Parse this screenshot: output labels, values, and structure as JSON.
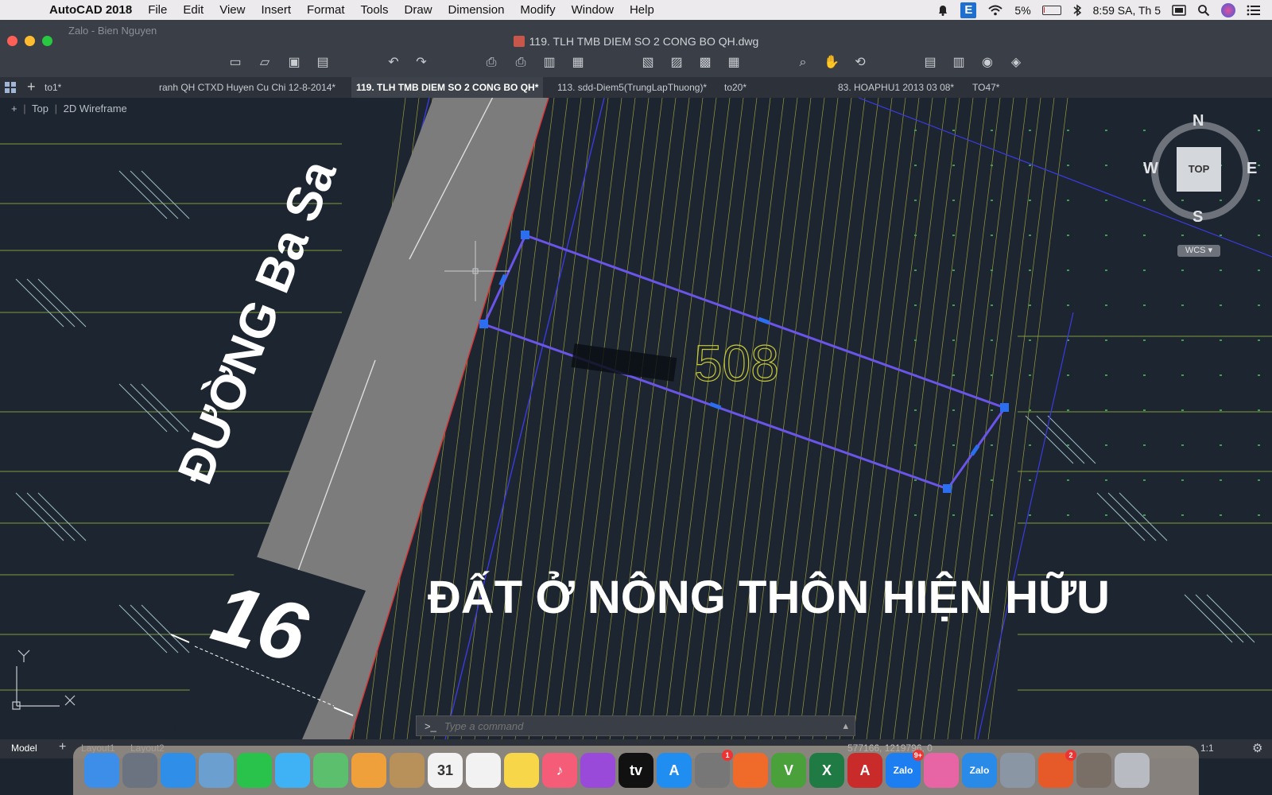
{
  "menubar": {
    "app_name": "AutoCAD 2018",
    "items": [
      "File",
      "Edit",
      "View",
      "Insert",
      "Format",
      "Tools",
      "Draw",
      "Dimension",
      "Modify",
      "Window",
      "Help"
    ],
    "battery": "5%",
    "clock": "8:59 SA, Th 5",
    "input_source": "E"
  },
  "window": {
    "title": "119. TLH TMB DIEM SO 2 CONG BO QH.dwg",
    "behind_window": "Zalo - Bien Nguyen"
  },
  "tabs": [
    {
      "label": "to1*"
    },
    {
      "label": "ranh QH CTXD Huyen Cu Chi 12-8-2014*"
    },
    {
      "label": "119. TLH TMB DIEM SO 2 CONG BO QH*",
      "active": true
    },
    {
      "label": "113. sdd-Diem5(TrungLapThuong)*"
    },
    {
      "label": "to20*"
    },
    {
      "label": "83. HOAPHU1 2013 03 08*"
    },
    {
      "label": "TO47*"
    }
  ],
  "viewport": {
    "view_label": "Top",
    "style_label": "2D Wireframe",
    "parcel_number": "508",
    "road_name": "ĐƯỜNG Ba Sa",
    "road_width": "16",
    "overlay_caption": "ĐẤT Ở NÔNG THÔN HIỆN HỮU",
    "viewcube": {
      "n": "N",
      "s": "S",
      "e": "E",
      "w": "W",
      "face": "TOP",
      "ucs": "WCS"
    },
    "ucs_axes": {
      "y": "Y",
      "x": "X"
    }
  },
  "command": {
    "prompt": ">_",
    "placeholder": "Type a command"
  },
  "statusbar": {
    "model_tab": "Model",
    "layout_tabs": [
      "Layout1",
      "Layout2"
    ],
    "coordinates": "577166, 1219796, 0",
    "scale": "1:1"
  },
  "dock": {
    "apps": [
      {
        "name": "Finder",
        "color": "#3c8ee8",
        "glyph": ""
      },
      {
        "name": "Launchpad",
        "color": "#6b7380",
        "glyph": ""
      },
      {
        "name": "Safari",
        "color": "#2f8fe8",
        "glyph": ""
      },
      {
        "name": "Preview",
        "color": "#6a9fcf",
        "glyph": ""
      },
      {
        "name": "FaceTime",
        "color": "#29c24a",
        "glyph": ""
      },
      {
        "name": "Messages",
        "color": "#3fb1f5",
        "glyph": ""
      },
      {
        "name": "Maps",
        "color": "#5bbf6d",
        "glyph": ""
      },
      {
        "name": "Photos",
        "color": "#f0a03a",
        "glyph": ""
      },
      {
        "name": "Contacts",
        "color": "#b8915a",
        "glyph": ""
      },
      {
        "name": "Calendar",
        "color": "#f2f2f2",
        "glyph": "31"
      },
      {
        "name": "Reminders",
        "color": "#f2f2f2",
        "glyph": ""
      },
      {
        "name": "Notes",
        "color": "#f7d64a",
        "glyph": ""
      },
      {
        "name": "Music",
        "color": "#f45c78",
        "glyph": "♪"
      },
      {
        "name": "Podcasts",
        "color": "#9a4ad8",
        "glyph": ""
      },
      {
        "name": "TV",
        "color": "#111111",
        "glyph": "tv"
      },
      {
        "name": "App Store",
        "color": "#1f8ef0",
        "glyph": "A"
      },
      {
        "name": "System Preferences",
        "color": "#777777",
        "glyph": "",
        "badge": "1"
      },
      {
        "name": "Brave",
        "color": "#f06a2a",
        "glyph": ""
      },
      {
        "name": "Vectorworks",
        "color": "#4aa03a",
        "glyph": "V"
      },
      {
        "name": "Excel",
        "color": "#1f7a44",
        "glyph": "X"
      },
      {
        "name": "AutoCAD",
        "color": "#c92a2a",
        "glyph": "A"
      },
      {
        "name": "Zalo",
        "color": "#1c7ef0",
        "glyph": "Zalo",
        "badge": "9+"
      },
      {
        "name": "Screen",
        "color": "#e865a5",
        "glyph": ""
      },
      {
        "name": "Zalo PC",
        "color": "#2a8ae8",
        "glyph": "Zalo"
      },
      {
        "name": "Image Capture",
        "color": "#8a96a4",
        "glyph": ""
      },
      {
        "name": "Microsoft Office",
        "color": "#e65a2a",
        "glyph": "",
        "badge": "2"
      },
      {
        "name": "Folder",
        "color": "#7a6f66",
        "glyph": ""
      },
      {
        "name": "Trash",
        "color": "#b8bcc2",
        "glyph": ""
      }
    ]
  }
}
